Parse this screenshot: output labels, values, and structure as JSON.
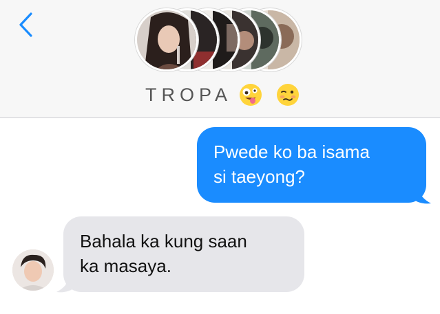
{
  "header": {
    "back_icon": "chevron-left-icon",
    "group_title": "TROPA",
    "title_emojis": [
      "zany-face-emoji",
      "woozy-face-emoji"
    ],
    "participant_count_shown": 6
  },
  "messages": [
    {
      "direction": "outgoing",
      "text_line1": "Pwede ko ba isama",
      "text_line2": "si taeyong?"
    },
    {
      "direction": "incoming",
      "text_line1": "Bahala ka kung saan",
      "text_line2": "ka masaya."
    }
  ],
  "colors": {
    "accent": "#1a8cff",
    "outgoing_bubble": "#1a8cff",
    "incoming_bubble": "#e6e6ea",
    "header_bg": "#f7f7f7",
    "title_text": "#555555"
  }
}
